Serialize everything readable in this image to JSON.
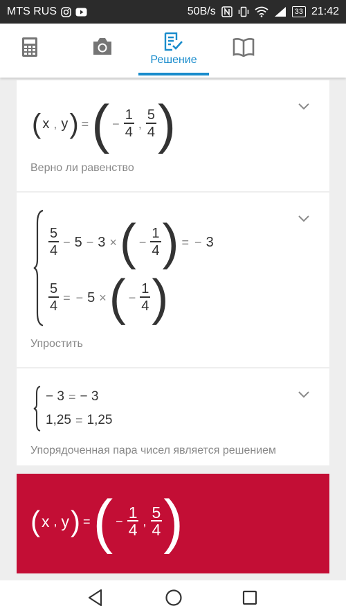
{
  "status_bar": {
    "carrier": "MTS RUS",
    "speed": "50B/s",
    "battery": "33",
    "time": "21:42"
  },
  "toolbar": {
    "active_label": "Решение",
    "accent_color": "#1a8ccc"
  },
  "steps": [
    {
      "math": {
        "lhs": [
          "x",
          ",",
          "y"
        ],
        "eq": "=",
        "minus": "−",
        "comma": ",",
        "frac1": {
          "num": "1",
          "den": "4"
        },
        "frac2": {
          "num": "5",
          "den": "4"
        }
      },
      "caption": "Верно ли равенство"
    },
    {
      "math": {
        "line1": {
          "frac_a": {
            "num": "5",
            "den": "4"
          },
          "t1": "−",
          "t2": "5",
          "t3": "−",
          "t4": "3",
          "t5": "×",
          "t6": "−",
          "frac_b": {
            "num": "1",
            "den": "4"
          },
          "t7": "=",
          "t8": "−",
          "t9": "3"
        },
        "line2": {
          "frac_a": {
            "num": "5",
            "den": "4"
          },
          "t1": "=",
          "t2": "−",
          "t3": "5",
          "t4": "×",
          "t5": "−",
          "frac_b": {
            "num": "1",
            "den": "4"
          }
        }
      },
      "caption": "Упростить"
    },
    {
      "math": {
        "line1": {
          "a": "− 3",
          "eq": "=",
          "b": "− 3"
        },
        "line2": {
          "a": "1,25",
          "eq": "=",
          "b": "1,25"
        }
      },
      "caption": "Упорядоченная пара чисел является решением"
    }
  ],
  "result": {
    "lhs": [
      "x",
      ",",
      "y"
    ],
    "eq": "=",
    "minus": "−",
    "comma": ",",
    "frac1": {
      "num": "1",
      "den": "4"
    },
    "frac2": {
      "num": "5",
      "den": "4"
    },
    "bg_color": "#c30e35"
  }
}
